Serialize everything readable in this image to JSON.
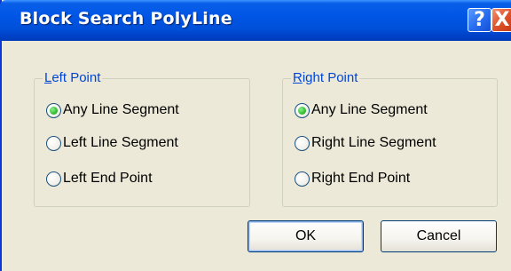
{
  "window": {
    "title": "Block Search PolyLine",
    "help_glyph": "?",
    "close_glyph": "X"
  },
  "left_group": {
    "mnemonic": "L",
    "label_rest": "eft Point",
    "options": [
      {
        "label": "Any Line Segment",
        "checked": true
      },
      {
        "label": "Left Line Segment",
        "checked": false
      },
      {
        "label": "Left End Point",
        "checked": false
      }
    ]
  },
  "right_group": {
    "mnemonic": "R",
    "label_rest": "ight Point",
    "options": [
      {
        "label": "Any Line Segment",
        "checked": true
      },
      {
        "label": "Right Line Segment",
        "checked": false
      },
      {
        "label": "Right End Point",
        "checked": false
      }
    ]
  },
  "buttons": {
    "ok": "OK",
    "cancel": "Cancel"
  },
  "colors": {
    "titlebar": "#0055e5",
    "dialog_bg": "#ece9d8",
    "group_label": "#0046d5",
    "radio_checked": "#37c437"
  }
}
